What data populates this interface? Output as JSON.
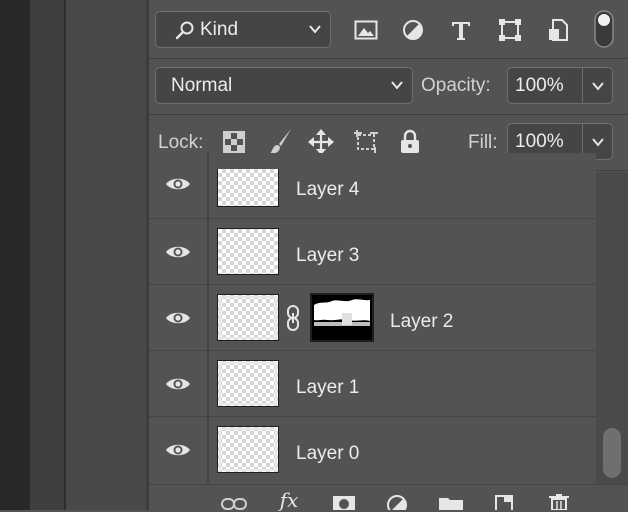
{
  "filter": {
    "kind_label": "Kind",
    "icons": [
      "image-filter-icon",
      "adjustment-filter-icon",
      "type-filter-icon",
      "shape-filter-icon",
      "smart-object-filter-icon",
      "filter-toggle-icon"
    ]
  },
  "blend": {
    "mode": "Normal",
    "opacity_label": "Opacity:",
    "opacity_value": "100%"
  },
  "lock": {
    "label": "Lock:",
    "fill_label": "Fill:",
    "fill_value": "100%"
  },
  "layers": [
    {
      "name": "Layer 4"
    },
    {
      "name": "Layer 3"
    },
    {
      "name": "Layer 2"
    },
    {
      "name": "Layer 1"
    },
    {
      "name": "Layer 0"
    }
  ],
  "footer_icons": [
    "link-layers-icon",
    "fx-icon",
    "mask-icon",
    "adjustment-layer-icon",
    "group-folder-icon",
    "new-layer-icon",
    "trash-icon"
  ],
  "footer": {
    "fx_label": "fx"
  }
}
